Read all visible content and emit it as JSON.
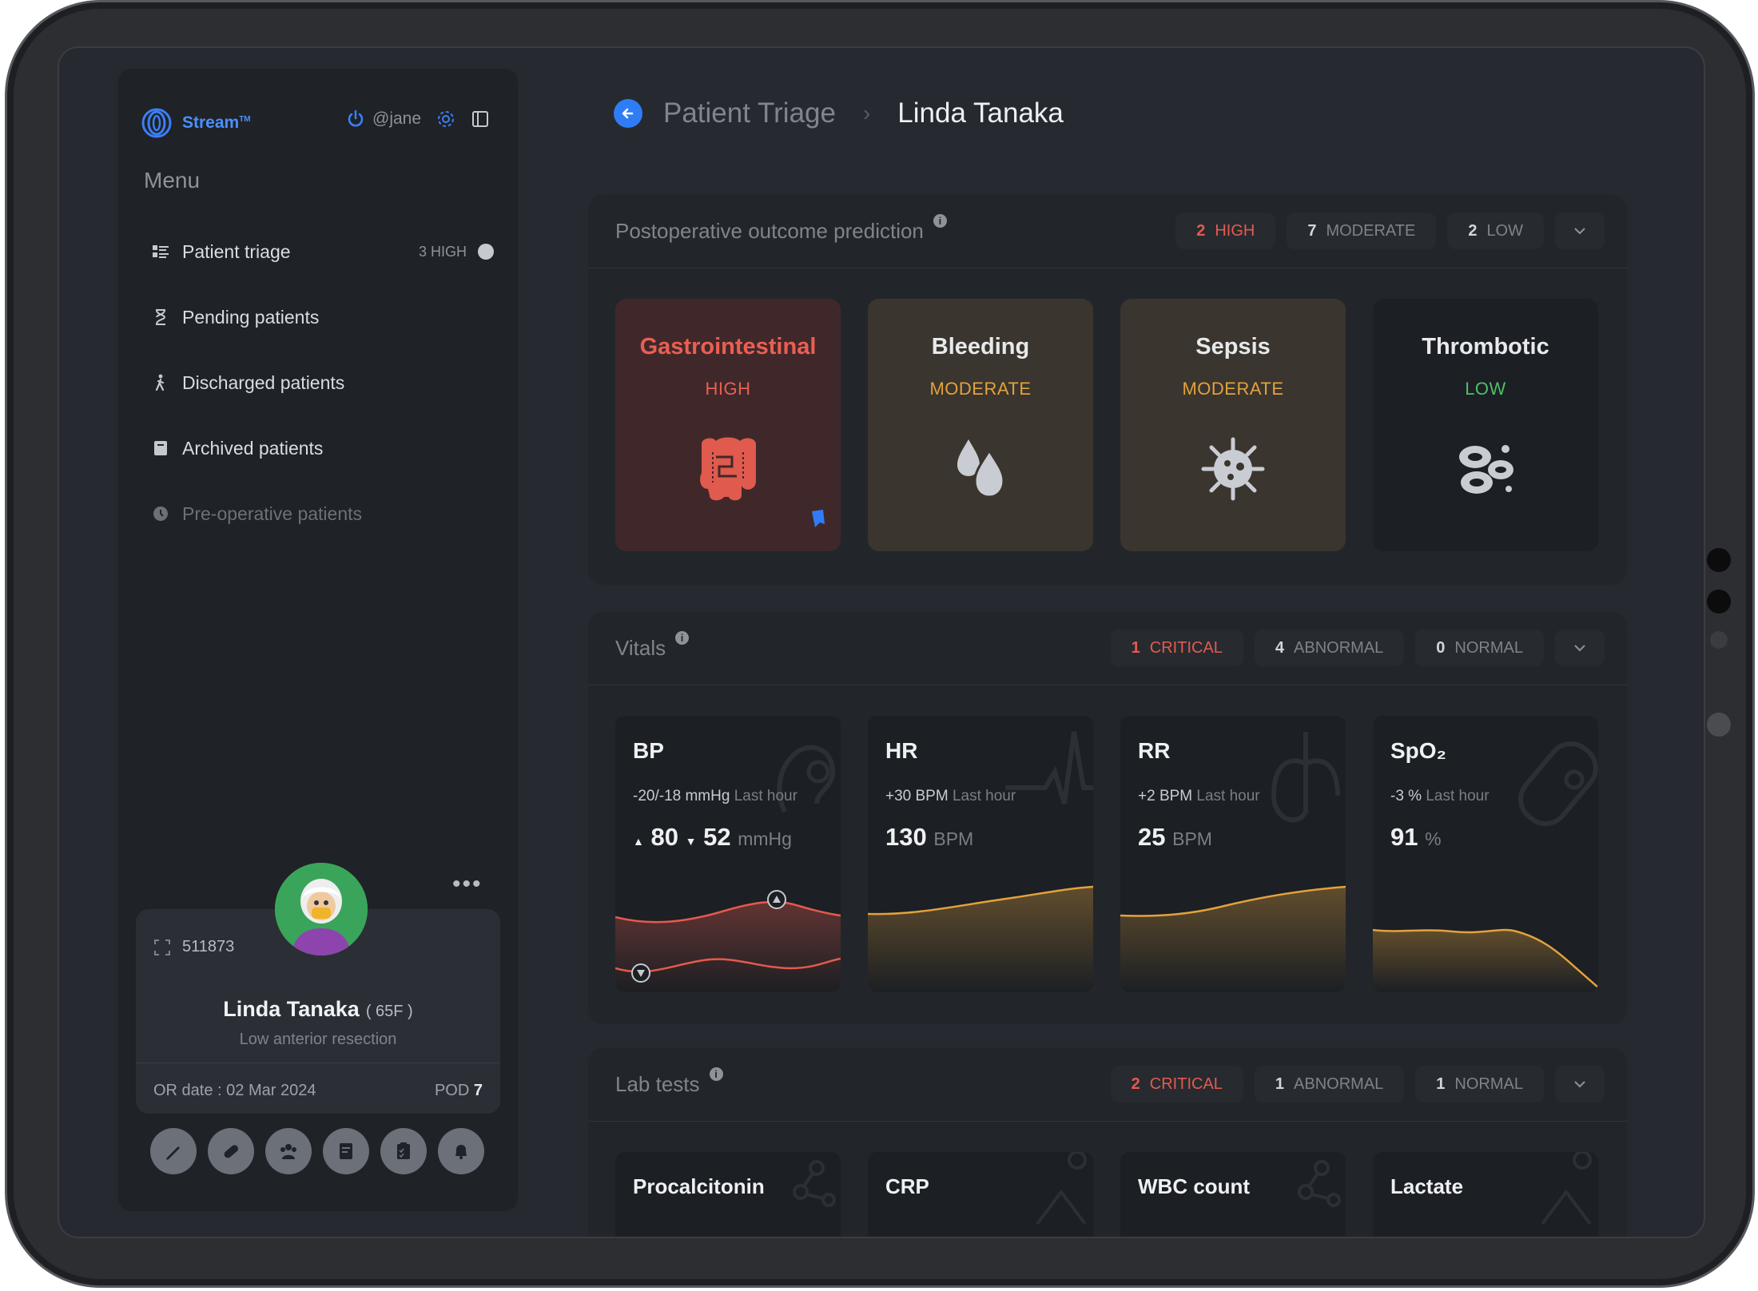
{
  "app": {
    "brand": "Stream",
    "trademark": "TM",
    "user": "@jane"
  },
  "menu": {
    "title": "Menu",
    "items": [
      {
        "label": "Patient triage",
        "badge": "3 HIGH"
      },
      {
        "label": "Pending patients"
      },
      {
        "label": "Discharged patients"
      },
      {
        "label": "Archived patients"
      },
      {
        "label": "Pre-operative patients"
      }
    ]
  },
  "patient": {
    "id": "511873",
    "name": "Linda Tanaka",
    "age": "( 65F )",
    "procedure": "Low anterior resection",
    "or_date": "OR date : 02 Mar 2024",
    "pod_label": "POD",
    "pod_value": "7",
    "more": "•••"
  },
  "breadcrumb": {
    "parent": "Patient Triage",
    "current": "Linda Tanaka",
    "separator": "›"
  },
  "outcome": {
    "title": "Postoperative outcome prediction",
    "info": "i",
    "counts": [
      {
        "num": "2",
        "label": "HIGH"
      },
      {
        "num": "7",
        "label": "MODERATE"
      },
      {
        "num": "2",
        "label": "LOW"
      }
    ],
    "risks": [
      {
        "title": "Gastrointestinal",
        "level": "HIGH"
      },
      {
        "title": "Bleeding",
        "level": "MODERATE"
      },
      {
        "title": "Sepsis",
        "level": "MODERATE"
      },
      {
        "title": "Thrombotic",
        "level": "LOW"
      }
    ]
  },
  "vitals": {
    "title": "Vitals",
    "info": "i",
    "counts": [
      {
        "num": "1",
        "label": "CRITICAL"
      },
      {
        "num": "4",
        "label": "ABNORMAL"
      },
      {
        "num": "0",
        "label": "NORMAL"
      }
    ],
    "items": [
      {
        "name": "BP",
        "delta": "-20/-18 mmHg",
        "period": "Last hour",
        "val1": "80",
        "val2": "52",
        "unit": "mmHg"
      },
      {
        "name": "HR",
        "delta": "+30 BPM",
        "period": "Last hour",
        "value": "130",
        "unit": "BPM"
      },
      {
        "name": "RR",
        "delta": "+2 BPM",
        "period": "Last hour",
        "value": "25",
        "unit": "BPM"
      },
      {
        "name": "SpO₂",
        "delta": "-3 %",
        "period": "Last hour",
        "value": "91",
        "unit": "%"
      }
    ]
  },
  "labs": {
    "title": "Lab tests",
    "info": "i",
    "counts": [
      {
        "num": "2",
        "label": "CRITICAL"
      },
      {
        "num": "1",
        "label": "ABNORMAL"
      },
      {
        "num": "1",
        "label": "NORMAL"
      }
    ],
    "items": [
      {
        "name": "Procalcitonin"
      },
      {
        "name": "CRP"
      },
      {
        "name": "WBC count"
      },
      {
        "name": "Lactate"
      }
    ]
  },
  "colors": {
    "critical": "#e45a4e",
    "moderate": "#e2a23e",
    "low": "#4fbf6a",
    "accent": "#2f7df6"
  }
}
